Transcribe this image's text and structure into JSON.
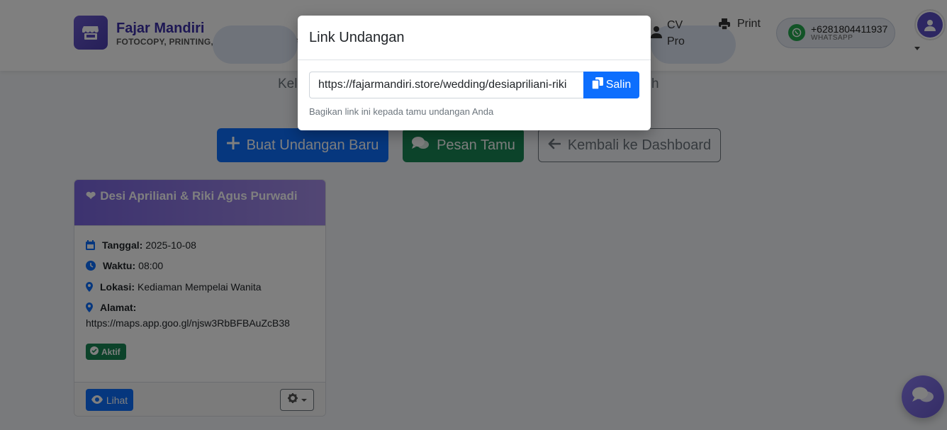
{
  "header": {
    "brand_name": "Fajar Mandiri",
    "brand_sub": "FOTOCOPY, PRINTING, OFFICE STATIONERY",
    "nav_cv": "CV Pro",
    "nav_print": "Print",
    "whatsapp_number": "+6281804411937",
    "whatsapp_label": "WHATSAPP"
  },
  "page": {
    "subtitle_left": "Kel",
    "subtitle_right": "h"
  },
  "actions": {
    "create_label": "Buat Undangan Baru",
    "guest_messages_label": "Pesan Tamu",
    "back_label": "Kembali ke Dashboard"
  },
  "card": {
    "title": "Desi Apriliani & Riki Agus Purwadi",
    "date_label": "Tanggal:",
    "date_value": "2025-10-08",
    "time_label": "Waktu:",
    "time_value": "08:00",
    "location_label": "Lokasi:",
    "location_value": "Kediaman Mempelai Wanita",
    "address_label": "Alamat:",
    "address_value": "https://maps.app.goo.gl/njsw3RbBFBAuZcB38",
    "status": "Aktif",
    "view_label": "Lihat"
  },
  "modal": {
    "title": "Link Undangan",
    "link_value": "https://fajarmandiri.store/wedding/desiapriliani-riki",
    "copy_label": "Salin",
    "help_text": "Bagikan link ini kepada tamu undangan Anda"
  },
  "colors": {
    "primary": "#0d6efd",
    "success": "#198754",
    "brand": "#3b2fa8"
  }
}
